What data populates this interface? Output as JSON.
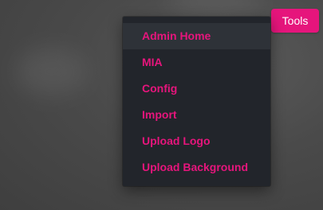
{
  "toolbar": {
    "tools_label": "Tools"
  },
  "menu": {
    "items": [
      {
        "label": "Admin Home"
      },
      {
        "label": "MIA"
      },
      {
        "label": "Config"
      },
      {
        "label": "Import"
      },
      {
        "label": "Upload Logo"
      },
      {
        "label": "Upload Background"
      }
    ]
  },
  "colors": {
    "accent": "#e6157c",
    "menu_background": "#22252b",
    "menu_hover": "#2e3238"
  }
}
